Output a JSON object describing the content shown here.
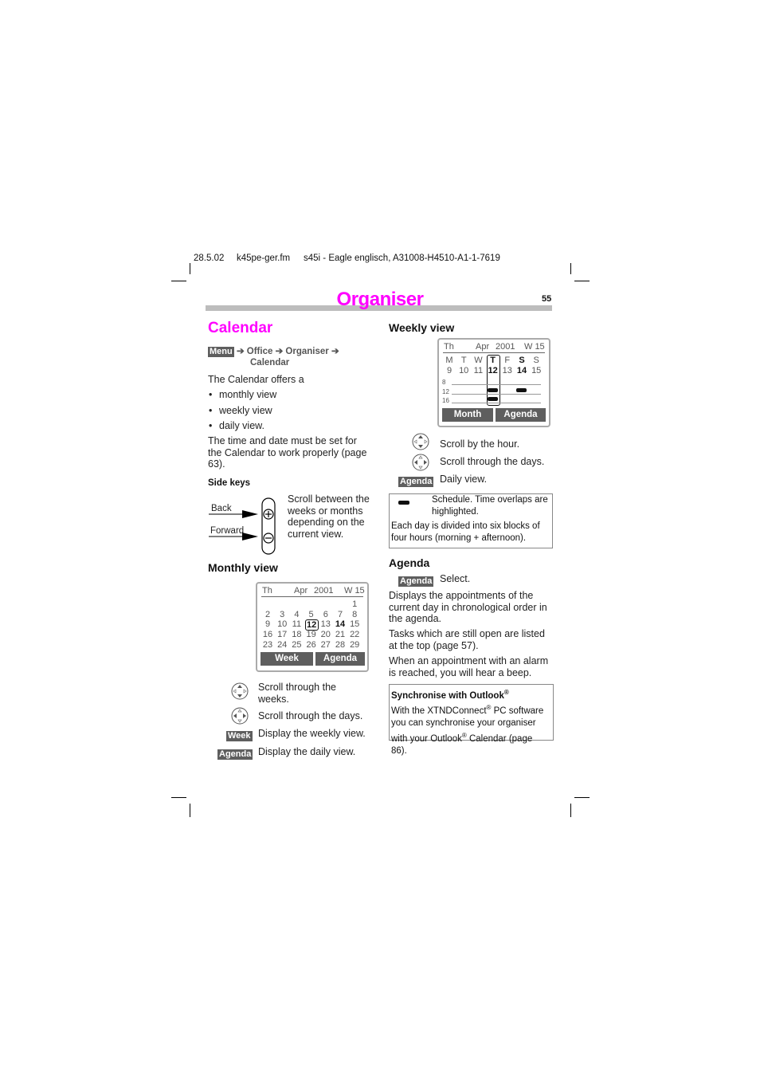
{
  "header": {
    "date": "28.5.02",
    "file": "k45pe-ger.fm",
    "product": "s45i - Eagle",
    "doc": "englisch, A31008-H4510-A1-1-7619"
  },
  "page": {
    "chapter_title": "Organiser",
    "page_number": "55",
    "title_color": "#ff00ff",
    "bar_color": "#bdbdbd"
  },
  "left": {
    "section_title": "Calendar",
    "menu_path": {
      "key": "Menu",
      "steps": [
        "Office",
        "Organiser",
        "Calendar"
      ],
      "arrow": "➔"
    },
    "intro": "The Calendar offers a",
    "bullets": [
      "monthly view",
      "weekly view",
      "daily view."
    ],
    "note": "The time and date must be set for the Calendar to work properly (page 63).",
    "side_keys": {
      "heading": "Side keys",
      "back_label": "Back",
      "forward_label": "Forward",
      "description": "Scroll between the weeks or months depending on the current view."
    },
    "monthly_view": {
      "heading": "Monthly view",
      "screen": {
        "day": "Th",
        "month": "Apr",
        "year": "2001",
        "week": "W 15",
        "rows": [
          [
            "",
            "",
            "",
            "",
            "",
            "",
            "1"
          ],
          [
            "2",
            "3",
            "4",
            "5",
            "6",
            "7",
            "8"
          ],
          [
            "9",
            "10",
            "11",
            "12",
            "13",
            "14",
            "15"
          ],
          [
            "16",
            "17",
            "18",
            "19",
            "20",
            "21",
            "22"
          ],
          [
            "23",
            "24",
            "25",
            "26",
            "27",
            "28",
            "29"
          ]
        ],
        "selected_day": "12",
        "bold_day": "14",
        "softkey_left": "Week",
        "softkey_right": "Agenda"
      },
      "instructions": [
        {
          "icon": "nav-up-down-icon",
          "text": "Scroll through the weeks."
        },
        {
          "icon": "nav-left-right-icon",
          "text": "Scroll through the days."
        },
        {
          "key": "Week",
          "text": "Display the weekly view."
        },
        {
          "key": "Agenda",
          "text": "Display the daily view."
        }
      ]
    }
  },
  "right": {
    "weekly_view": {
      "heading": "Weekly view",
      "screen": {
        "day": "Th",
        "month": "Apr",
        "year": "2001",
        "week": "W 15",
        "weekdays": [
          "M",
          "T",
          "W",
          "T",
          "F",
          "S",
          "S"
        ],
        "dates": [
          "9",
          "10",
          "11",
          "12",
          "13",
          "14",
          "15"
        ],
        "hours": [
          "8",
          "12",
          "16"
        ],
        "selected_index": 3,
        "bold_index": 5,
        "softkey_left": "Month",
        "softkey_right": "Agenda"
      },
      "instructions": [
        {
          "icon": "nav-up-down-icon",
          "text": "Scroll by the hour."
        },
        {
          "icon": "nav-left-right-icon",
          "text": "Scroll through the days."
        },
        {
          "key": "Agenda",
          "text": "Daily view."
        }
      ],
      "legend_box": {
        "schedule_text": "Schedule. Time overlaps are highlighted.",
        "blocks_text": "Each day is divided into six blocks of four hours (morning + afternoon)."
      }
    },
    "agenda": {
      "heading": "Agenda",
      "key": "Agenda",
      "key_text": "Select.",
      "paragraphs": [
        "Displays the appointments of the current day in chronological order in the agenda.",
        "Tasks which are still open are listed at the top (page 57).",
        "When an appointment with an alarm is reached, you will hear a beep."
      ]
    },
    "sync_box": {
      "title": "Synchronise with Outlook",
      "title_sup": "®",
      "line1a": "With the XTNDConnect",
      "sup": "®",
      "line1b": " PC software you can synchronise your organiser with your Outlook",
      "line1c": " Calendar (page 86)."
    }
  }
}
